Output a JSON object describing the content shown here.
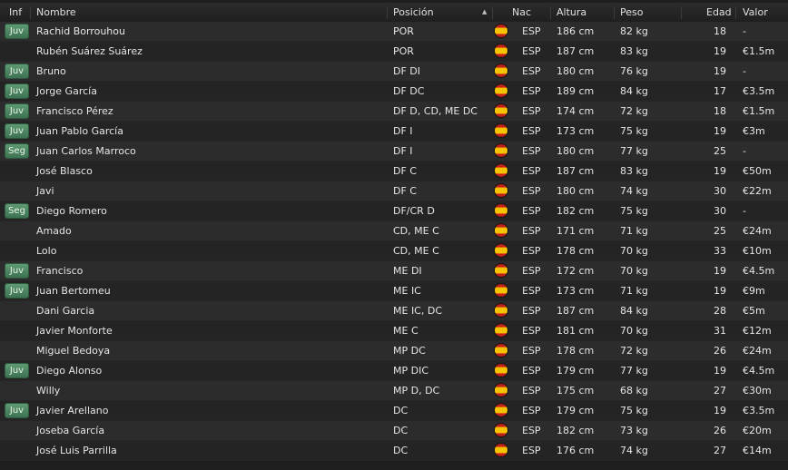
{
  "columns": {
    "inf": "Inf",
    "nombre": "Nombre",
    "posicion": "Posición",
    "nac": "Nac",
    "altura": "Altura",
    "peso": "Peso",
    "edad": "Edad",
    "valor": "Valor"
  },
  "sort_indicator": "▲",
  "players": [
    {
      "inf": "Juv",
      "nombre": "Rachid Borrouhou",
      "posicion": "POR",
      "nac": "ESP",
      "altura": "186 cm",
      "peso": "82 kg",
      "edad": "18",
      "valor": "-"
    },
    {
      "inf": "",
      "nombre": "Rubén Suárez Suárez",
      "posicion": "POR",
      "nac": "ESP",
      "altura": "187 cm",
      "peso": "83 kg",
      "edad": "19",
      "valor": "€1.5m"
    },
    {
      "inf": "Juv",
      "nombre": "Bruno",
      "posicion": "DF DI",
      "nac": "ESP",
      "altura": "180 cm",
      "peso": "76 kg",
      "edad": "19",
      "valor": "-"
    },
    {
      "inf": "Juv",
      "nombre": "Jorge García",
      "posicion": "DF DC",
      "nac": "ESP",
      "altura": "189 cm",
      "peso": "84 kg",
      "edad": "17",
      "valor": "€3.5m"
    },
    {
      "inf": "Juv",
      "nombre": "Francisco Pérez",
      "posicion": "DF D, CD, ME DC",
      "nac": "ESP",
      "altura": "174 cm",
      "peso": "72 kg",
      "edad": "18",
      "valor": "€1.5m"
    },
    {
      "inf": "Juv",
      "nombre": "Juan Pablo García",
      "posicion": "DF I",
      "nac": "ESP",
      "altura": "173 cm",
      "peso": "75 kg",
      "edad": "19",
      "valor": "€3m"
    },
    {
      "inf": "Seg",
      "nombre": "Juan Carlos Marroco",
      "posicion": "DF I",
      "nac": "ESP",
      "altura": "180 cm",
      "peso": "77 kg",
      "edad": "25",
      "valor": "-"
    },
    {
      "inf": "",
      "nombre": "José Blasco",
      "posicion": "DF C",
      "nac": "ESP",
      "altura": "187 cm",
      "peso": "83 kg",
      "edad": "19",
      "valor": "€50m"
    },
    {
      "inf": "",
      "nombre": "Javi",
      "posicion": "DF C",
      "nac": "ESP",
      "altura": "180 cm",
      "peso": "74 kg",
      "edad": "30",
      "valor": "€22m"
    },
    {
      "inf": "Seg",
      "nombre": "Diego Romero",
      "posicion": "DF/CR D",
      "nac": "ESP",
      "altura": "182 cm",
      "peso": "75 kg",
      "edad": "30",
      "valor": "-"
    },
    {
      "inf": "",
      "nombre": "Amado",
      "posicion": "CD, ME C",
      "nac": "ESP",
      "altura": "171 cm",
      "peso": "71 kg",
      "edad": "25",
      "valor": "€24m"
    },
    {
      "inf": "",
      "nombre": "Lolo",
      "posicion": "CD, ME C",
      "nac": "ESP",
      "altura": "178 cm",
      "peso": "70 kg",
      "edad": "33",
      "valor": "€10m"
    },
    {
      "inf": "Juv",
      "nombre": "Francisco",
      "posicion": "ME DI",
      "nac": "ESP",
      "altura": "172 cm",
      "peso": "70 kg",
      "edad": "19",
      "valor": "€4.5m"
    },
    {
      "inf": "Juv",
      "nombre": "Juan Bertomeu",
      "posicion": "ME IC",
      "nac": "ESP",
      "altura": "173 cm",
      "peso": "71 kg",
      "edad": "19",
      "valor": "€9m"
    },
    {
      "inf": "",
      "nombre": "Dani Garcia",
      "posicion": "ME IC, DC",
      "nac": "ESP",
      "altura": "187 cm",
      "peso": "84 kg",
      "edad": "28",
      "valor": "€5m"
    },
    {
      "inf": "",
      "nombre": "Javier Monforte",
      "posicion": "ME C",
      "nac": "ESP",
      "altura": "181 cm",
      "peso": "70 kg",
      "edad": "31",
      "valor": "€12m"
    },
    {
      "inf": "",
      "nombre": "Miguel Bedoya",
      "posicion": "MP DC",
      "nac": "ESP",
      "altura": "178 cm",
      "peso": "72 kg",
      "edad": "26",
      "valor": "€24m"
    },
    {
      "inf": "Juv",
      "nombre": "Diego Alonso",
      "posicion": "MP DIC",
      "nac": "ESP",
      "altura": "179 cm",
      "peso": "77 kg",
      "edad": "19",
      "valor": "€4.5m"
    },
    {
      "inf": "",
      "nombre": "Willy",
      "posicion": "MP D, DC",
      "nac": "ESP",
      "altura": "175 cm",
      "peso": "68 kg",
      "edad": "27",
      "valor": "€30m"
    },
    {
      "inf": "Juv",
      "nombre": "Javier Arellano",
      "posicion": "DC",
      "nac": "ESP",
      "altura": "179 cm",
      "peso": "75 kg",
      "edad": "19",
      "valor": "€3.5m"
    },
    {
      "inf": "",
      "nombre": "Joseba García",
      "posicion": "DC",
      "nac": "ESP",
      "altura": "182 cm",
      "peso": "73 kg",
      "edad": "26",
      "valor": "€20m"
    },
    {
      "inf": "",
      "nombre": "José Luis Parrilla",
      "posicion": "DC",
      "nac": "ESP",
      "altura": "176 cm",
      "peso": "74 kg",
      "edad": "27",
      "valor": "€14m"
    }
  ]
}
